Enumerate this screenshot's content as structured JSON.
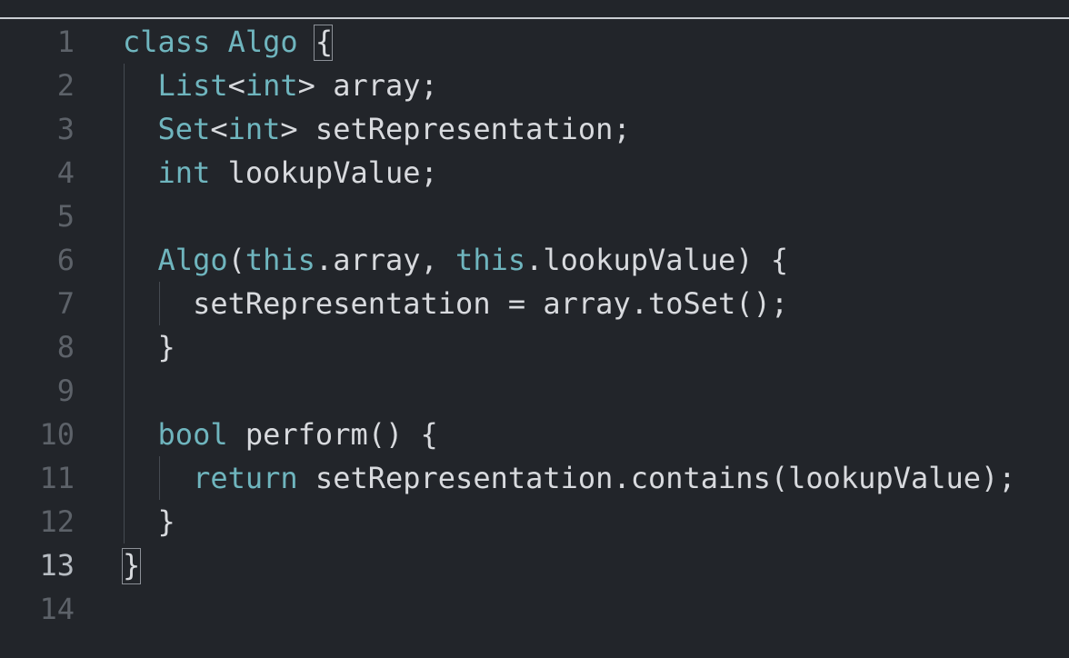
{
  "editor": {
    "active_line": 13,
    "colors": {
      "background": "#22252a",
      "keyword": "#6fb5be",
      "text": "#d8dade",
      "line_number": "#5d6269",
      "active_line_number": "#b7bcc2"
    },
    "lines": [
      {
        "num": "1",
        "tokens": [
          [
            "kw",
            "class"
          ],
          [
            "id",
            " "
          ],
          [
            "kw",
            "Algo"
          ],
          [
            "id",
            " "
          ],
          [
            "id",
            "{"
          ]
        ]
      },
      {
        "num": "2",
        "tokens": [
          [
            "id",
            "  "
          ],
          [
            "kw",
            "List"
          ],
          [
            "id",
            "<"
          ],
          [
            "kw",
            "int"
          ],
          [
            "id",
            "> array;"
          ]
        ]
      },
      {
        "num": "3",
        "tokens": [
          [
            "id",
            "  "
          ],
          [
            "kw",
            "Set"
          ],
          [
            "id",
            "<"
          ],
          [
            "kw",
            "int"
          ],
          [
            "id",
            "> setRepresentation;"
          ]
        ]
      },
      {
        "num": "4",
        "tokens": [
          [
            "id",
            "  "
          ],
          [
            "kw",
            "int"
          ],
          [
            "id",
            " lookupValue;"
          ]
        ]
      },
      {
        "num": "5",
        "tokens": []
      },
      {
        "num": "6",
        "tokens": [
          [
            "id",
            "  "
          ],
          [
            "kw",
            "Algo"
          ],
          [
            "id",
            "("
          ],
          [
            "kw",
            "this"
          ],
          [
            "id",
            ".array, "
          ],
          [
            "kw",
            "this"
          ],
          [
            "id",
            ".lookupValue) {"
          ]
        ]
      },
      {
        "num": "7",
        "tokens": [
          [
            "id",
            "    setRepresentation = array.toSet();"
          ]
        ]
      },
      {
        "num": "8",
        "tokens": [
          [
            "id",
            "  }"
          ]
        ]
      },
      {
        "num": "9",
        "tokens": []
      },
      {
        "num": "10",
        "tokens": [
          [
            "id",
            "  "
          ],
          [
            "kw",
            "bool"
          ],
          [
            "id",
            " perform() {"
          ]
        ]
      },
      {
        "num": "11",
        "tokens": [
          [
            "id",
            "    "
          ],
          [
            "kw",
            "return"
          ],
          [
            "id",
            " setRepresentation.contains(lookupValue);"
          ]
        ]
      },
      {
        "num": "12",
        "tokens": [
          [
            "id",
            "  }"
          ]
        ]
      },
      {
        "num": "13",
        "tokens": [
          [
            "id",
            "}"
          ]
        ]
      },
      {
        "num": "14",
        "tokens": []
      }
    ]
  }
}
